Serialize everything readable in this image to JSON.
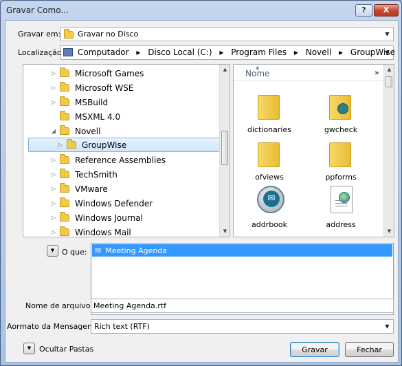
{
  "window": {
    "title": "Gravar Como...",
    "help_label": "?",
    "close_label": "X"
  },
  "save_in": {
    "label": "Gravar em:",
    "value": "Gravar no Disco"
  },
  "location": {
    "label": "Localização:",
    "crumbs": [
      "Computador",
      "Disco Local (C:)",
      "Program Files",
      "Novell",
      "GroupWise"
    ]
  },
  "tree": {
    "items": [
      {
        "label": "Microsoft Games",
        "expander": "▷"
      },
      {
        "label": "Microsoft WSE",
        "expander": "▷"
      },
      {
        "label": "MSBuild",
        "expander": "▷"
      },
      {
        "label": "MSXML 4.0",
        "expander": ""
      },
      {
        "label": "Novell",
        "expander": "◢"
      },
      {
        "label": "GroupWise",
        "expander": "▷",
        "selected": true
      },
      {
        "label": "Reference Assemblies",
        "expander": "▷"
      },
      {
        "label": "TechSmith",
        "expander": "▷"
      },
      {
        "label": "VMware",
        "expander": "▷"
      },
      {
        "label": "Windows Defender",
        "expander": "▷"
      },
      {
        "label": "Windows Journal",
        "expander": "▷"
      },
      {
        "label": "Windows Mail",
        "expander": "▷"
      }
    ]
  },
  "files": {
    "column_header": "Nome",
    "more": "»",
    "items": [
      {
        "label": "dictionaries",
        "icon": "folder"
      },
      {
        "label": "gwcheck",
        "icon": "folder-disc"
      },
      {
        "label": "ofviews",
        "icon": "folder"
      },
      {
        "label": "ppforms",
        "icon": "folder"
      },
      {
        "label": "addrbook",
        "icon": "addrbook-disc"
      },
      {
        "label": "address",
        "icon": "document-globe"
      }
    ]
  },
  "what": {
    "label": "O que:",
    "item": "Meeting Agenda"
  },
  "filename": {
    "label": "Nome de arquivo:",
    "value": "Meeting Agenda.rtf"
  },
  "format": {
    "label": "Aormato da Mensagem:",
    "value": "Rich text (RTF)"
  },
  "footer": {
    "hide_folders": "Ocultar Pastas",
    "save": "Gravar",
    "close": "Fechar"
  }
}
